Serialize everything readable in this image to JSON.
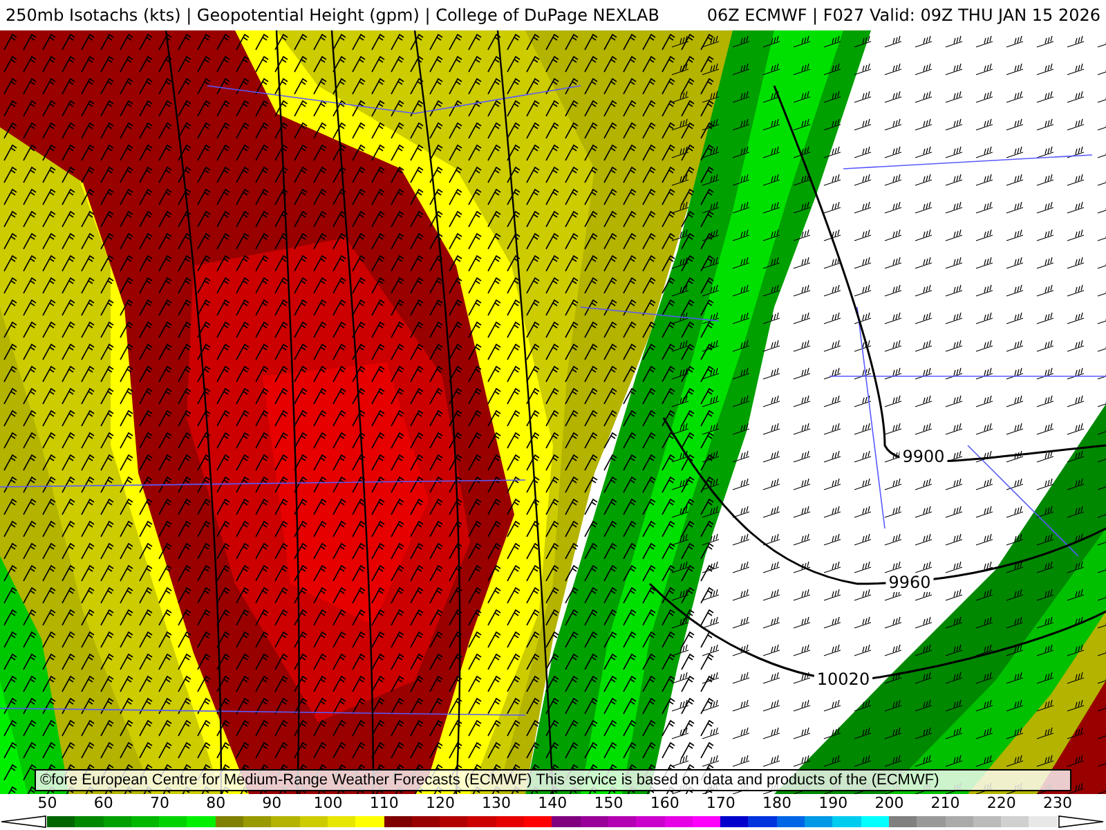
{
  "header": {
    "title": "250mb Isotachs (kts) | Geopotential Height (gpm) | College of DuPage NEXLAB",
    "run": "06Z ECMWF | F027 Valid: 09Z THU JAN 15 2026"
  },
  "map": {
    "contour_labels": [
      "9900",
      "9960",
      "10020"
    ],
    "attribution": "©fore European Centre for Medium-Range Weather Forecasts (ECMWF) This service is based on data and products of the (ECMWF)"
  },
  "legend": {
    "labels": [
      "50",
      "60",
      "70",
      "80",
      "90",
      "100",
      "110",
      "120",
      "130",
      "140",
      "150",
      "160",
      "170",
      "180",
      "190",
      "200",
      "210",
      "220",
      "230"
    ],
    "swatches": [
      {
        "color": "#006600"
      },
      {
        "color": "#008800"
      },
      {
        "color": "#00a000"
      },
      {
        "color": "#00b800"
      },
      {
        "color": "#00d400"
      },
      {
        "color": "#00f000"
      },
      {
        "color": "#808000"
      },
      {
        "color": "#999900"
      },
      {
        "color": "#b3b300"
      },
      {
        "color": "#cccc00"
      },
      {
        "color": "#e6e600"
      },
      {
        "color": "#ffff00"
      },
      {
        "color": "#800000"
      },
      {
        "color": "#990000"
      },
      {
        "color": "#b30000"
      },
      {
        "color": "#cc0000"
      },
      {
        "color": "#e60000"
      },
      {
        "color": "#ff0000"
      },
      {
        "color": "#800080"
      },
      {
        "color": "#990099"
      },
      {
        "color": "#b300b3"
      },
      {
        "color": "#cc00cc"
      },
      {
        "color": "#e600e6"
      },
      {
        "color": "#ff00ff"
      },
      {
        "color": "#0000cc"
      },
      {
        "color": "#0033dd"
      },
      {
        "color": "#0066e6"
      },
      {
        "color": "#0099e6"
      },
      {
        "color": "#00ccf0"
      },
      {
        "color": "#00ffff"
      },
      {
        "color": "#808080"
      },
      {
        "color": "#999999"
      },
      {
        "color": "#aaaaaa"
      },
      {
        "color": "#bbbbbb"
      },
      {
        "color": "#d0d0d0"
      },
      {
        "color": "#e8e8e8"
      }
    ]
  }
}
